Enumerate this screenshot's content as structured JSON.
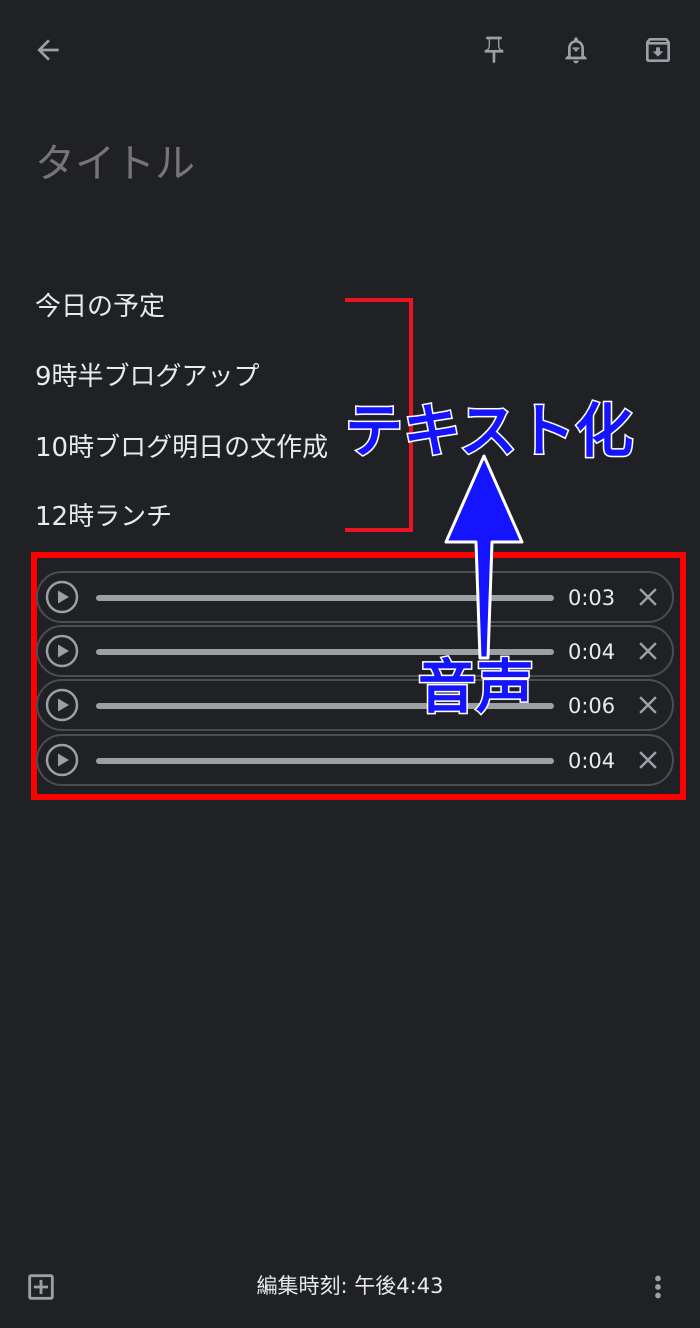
{
  "toolbar": {
    "back": "back-arrow-icon",
    "pin": "pin-icon",
    "reminder": "bell-plus-icon",
    "archive": "archive-icon"
  },
  "note": {
    "title_placeholder": "タイトル",
    "lines": [
      "今日の予定",
      "9時半ブログアップ",
      "10時ブログ明日の文作成",
      "12時ランチ"
    ]
  },
  "audio_clips": [
    {
      "duration": "0:03"
    },
    {
      "duration": "0:04"
    },
    {
      "duration": "0:06"
    },
    {
      "duration": "0:04"
    }
  ],
  "annotations": {
    "text_label": "テキスト化",
    "audio_label": "音声",
    "bracket_color": "#e8141f",
    "frame_color": "#ff0000",
    "label_color": "#1414ff"
  },
  "bottom_bar": {
    "add": "add-box-icon",
    "status": "編集時刻: 午後4:43",
    "more": "more-vert-icon"
  },
  "theme": {
    "background": "#202124",
    "text": "#e8eaed",
    "muted": "#9aa0a6"
  }
}
